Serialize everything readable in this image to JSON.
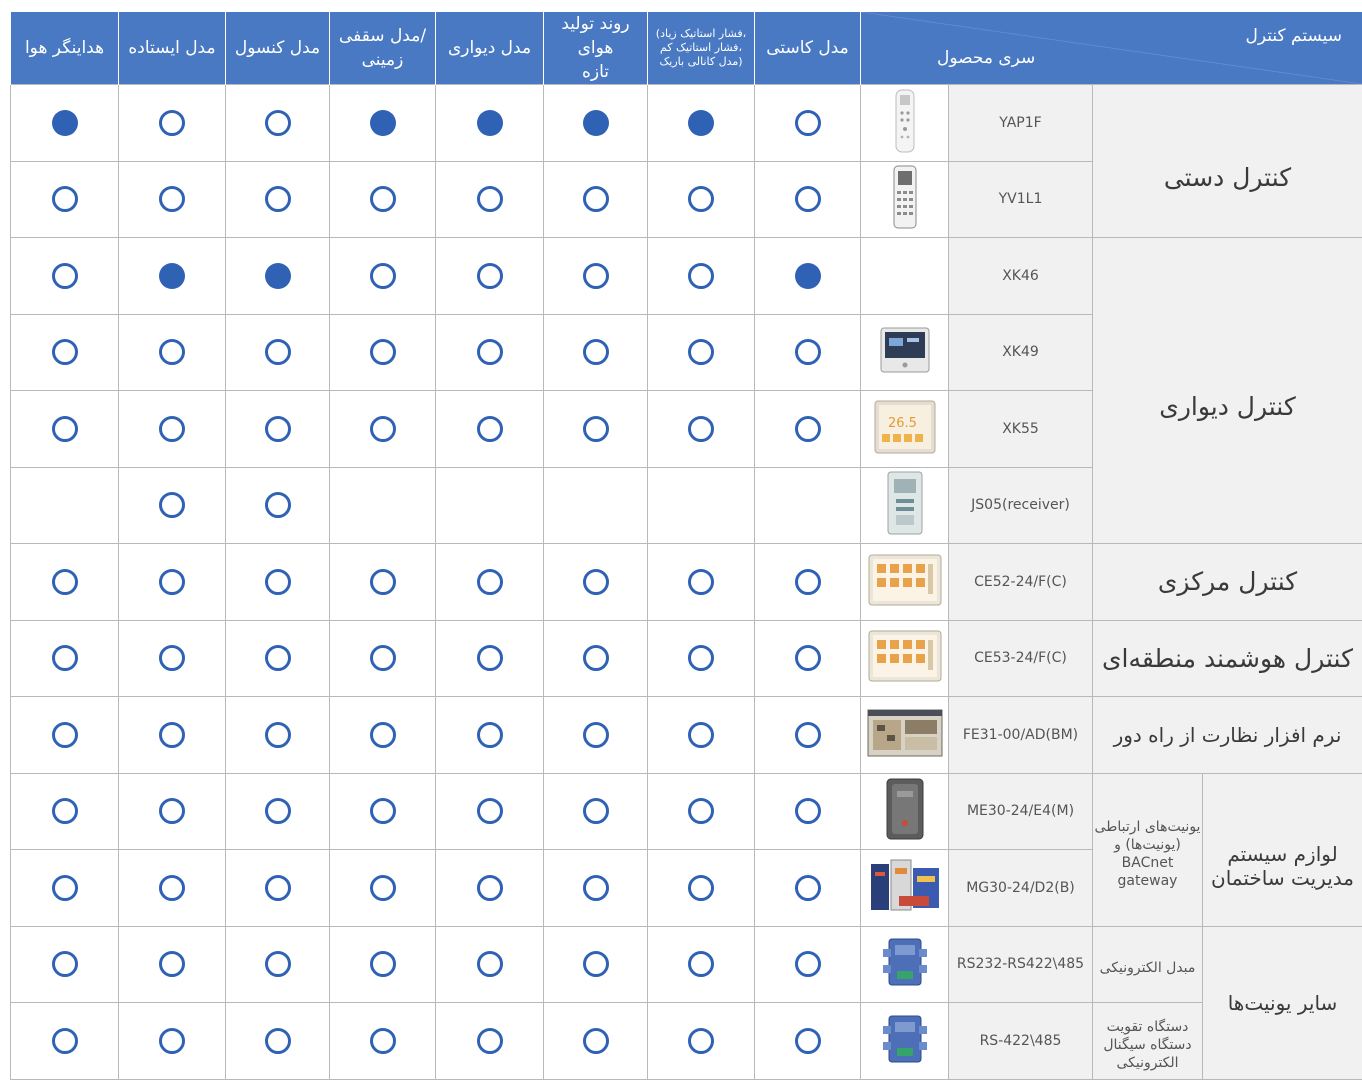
{
  "header": {
    "control_system": "سیستم کنترل",
    "product_series": "سری محصول",
    "columns": [
      {
        "lines": [
          "هداینگر هوا"
        ],
        "small": false
      },
      {
        "lines": [
          "مدل ایستاده"
        ],
        "small": false
      },
      {
        "lines": [
          "مدل کنسول"
        ],
        "small": false
      },
      {
        "lines": [
          "مدل سقفی/",
          "زمینی"
        ],
        "small": false
      },
      {
        "lines": [
          "مدل دیواری"
        ],
        "small": false
      },
      {
        "lines": [
          "روند تولید هوای",
          "تازه"
        ],
        "small": false
      },
      {
        "lines": [
          "(فشار استاتیک زیاد،",
          "فشار استاتیک کم،",
          "مدل کانالی باریک)"
        ],
        "small": true
      },
      {
        "lines": [
          "مدل کاستی"
        ],
        "small": false
      }
    ]
  },
  "categories": {
    "manual": "کنترل دستی",
    "wall": "کنترل دیواری",
    "central": "کنترل مرکزی",
    "smart_zone": "کنترل هوشمند منطقه‌ای",
    "remote_software": "نرم افزار نظارت از راه دور",
    "bms": "لوازم سیستم مدیریت ساختمان",
    "bms_sub": "یونیت‌های ارتباطی (یونیت‌ها) و BACnet gateway",
    "other": "سایر یونیت‌ها",
    "other_sub_1": "مبدل الکترونیکی",
    "other_sub_2": "دستگاه تقویت دستگاه سیگنال الکترونیکی"
  },
  "legend_note": "values order: هداینگر هوا, مدل ایستاده, مدل کنسول, مدل سقفی/زمینی, مدل دیواری, روند تولید هوای تازه, کانالی, مدل کاستی",
  "rows": [
    {
      "model": "YAP1F",
      "icon": "handheld-remote-icon",
      "values": [
        "open",
        "filled",
        "filled",
        "filled",
        "filled",
        "open",
        "open",
        "filled"
      ]
    },
    {
      "model": "YV1L1",
      "icon": "wired-remote-icon",
      "values": [
        "open",
        "open",
        "open",
        "open",
        "open",
        "open",
        "open",
        "open"
      ]
    },
    {
      "model": "XK46",
      "icon": "",
      "values": [
        "filled",
        "open",
        "open",
        "open",
        "open",
        "filled",
        "filled",
        "open"
      ]
    },
    {
      "model": "XK49",
      "icon": "wall-panel-icon",
      "values": [
        "open",
        "open",
        "open",
        "open",
        "open",
        "open",
        "open",
        "open"
      ]
    },
    {
      "model": "XK55",
      "icon": "touch-panel-icon",
      "values": [
        "open",
        "open",
        "open",
        "open",
        "open",
        "open",
        "open",
        "open"
      ]
    },
    {
      "model": "JS05(receiver)",
      "icon": "receiver-icon",
      "values": [
        "",
        "",
        "",
        "",
        "",
        "open",
        "open",
        ""
      ]
    },
    {
      "model": "CE52-24/F(C)",
      "icon": "central-controller-icon",
      "values": [
        "open",
        "open",
        "open",
        "open",
        "open",
        "open",
        "open",
        "open"
      ]
    },
    {
      "model": "CE53-24/F(C)",
      "icon": "zone-controller-icon",
      "values": [
        "open",
        "open",
        "open",
        "open",
        "open",
        "open",
        "open",
        "open"
      ]
    },
    {
      "model": "FE31-00/AD(BM)",
      "icon": "monitoring-software-icon",
      "values": [
        "open",
        "open",
        "open",
        "open",
        "open",
        "open",
        "open",
        "open"
      ]
    },
    {
      "model": "ME30-24/E4(M)",
      "icon": "gateway-module-icon",
      "values": [
        "open",
        "open",
        "open",
        "open",
        "open",
        "open",
        "open",
        "open"
      ]
    },
    {
      "model": "MG30-24/D2(B)",
      "icon": "bacnet-gateway-icon",
      "values": [
        "open",
        "open",
        "open",
        "open",
        "open",
        "open",
        "open",
        "open"
      ]
    },
    {
      "model": "RS232-RS422\\485",
      "icon": "converter-icon",
      "values": [
        "open",
        "open",
        "open",
        "open",
        "open",
        "open",
        "open",
        "open"
      ]
    },
    {
      "model": "RS-422\\485",
      "icon": "signal-repeater-icon",
      "values": [
        "open",
        "open",
        "open",
        "open",
        "open",
        "open",
        "open",
        "open"
      ]
    }
  ]
}
